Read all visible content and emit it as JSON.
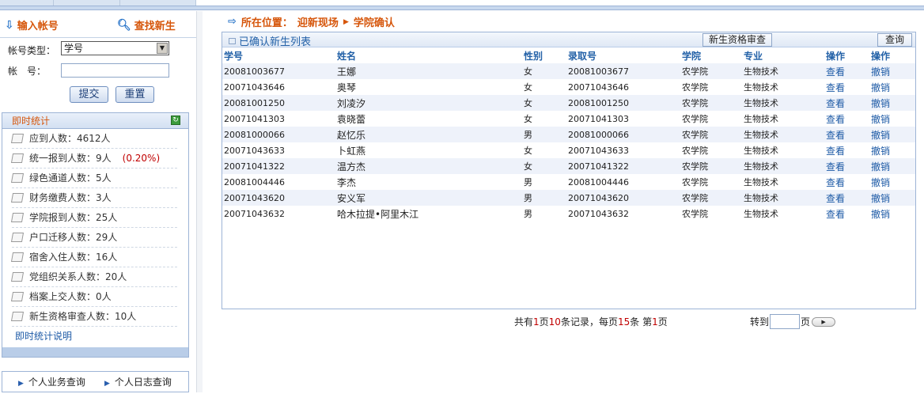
{
  "left": {
    "tabs": [
      {
        "icon": "down-arrow-icon",
        "label": "输入帐号"
      },
      {
        "icon": "search-icon",
        "label": "查找新生"
      }
    ],
    "account_type_label": "帐号类型：",
    "account_type_value": "学号",
    "account_label": "帐　号：",
    "account_value": "",
    "submit_label": "提交",
    "reset_label": "重置",
    "stats_title": "即时统计",
    "stats": [
      {
        "text": "应到人数：4612人",
        "pct": ""
      },
      {
        "text": "统一报到人数：9人",
        "pct": "(0.20%)"
      },
      {
        "text": "绿色通道人数：5人",
        "pct": ""
      },
      {
        "text": "财务缴费人数：3人",
        "pct": ""
      },
      {
        "text": "学院报到人数：25人",
        "pct": ""
      },
      {
        "text": "户口迁移人数：29人",
        "pct": ""
      },
      {
        "text": "宿舍入住人数：16人",
        "pct": ""
      },
      {
        "text": "党组织关系人数：20人",
        "pct": ""
      },
      {
        "text": "档案上交人数：0人",
        "pct": ""
      },
      {
        "text": "新生资格审查人数：10人",
        "pct": ""
      }
    ],
    "stats_link": "即时统计说明",
    "bottom_links": [
      "个人业务查询",
      "个人日志查询"
    ]
  },
  "breadcrumb": {
    "prefix": "所在位置：",
    "items": [
      "迎新现场",
      "学院确认"
    ]
  },
  "panel": {
    "title": "已确认新生列表",
    "review_button": "新生资格审查",
    "query_button": "查询",
    "columns": [
      "学号",
      "姓名",
      "性别",
      "录取号",
      "学院",
      "专业",
      "操作",
      "操作"
    ],
    "rows": [
      [
        "20081003677",
        "王娜",
        "女",
        "20081003677",
        "农学院",
        "生物技术",
        "查看",
        "撤销"
      ],
      [
        "20071043646",
        "奥琴",
        "女",
        "20071043646",
        "农学院",
        "生物技术",
        "查看",
        "撤销"
      ],
      [
        "20081001250",
        "刘凌汐",
        "女",
        "20081001250",
        "农学院",
        "生物技术",
        "查看",
        "撤销"
      ],
      [
        "20071041303",
        "袁晓蕾",
        "女",
        "20071041303",
        "农学院",
        "生物技术",
        "查看",
        "撤销"
      ],
      [
        "20081000066",
        "赵忆乐",
        "男",
        "20081000066",
        "农学院",
        "生物技术",
        "查看",
        "撤销"
      ],
      [
        "20071043633",
        "卜虹燕",
        "女",
        "20071043633",
        "农学院",
        "生物技术",
        "查看",
        "撤销"
      ],
      [
        "20071041322",
        "温方杰",
        "女",
        "20071041322",
        "农学院",
        "生物技术",
        "查看",
        "撤销"
      ],
      [
        "20081004446",
        "李杰",
        "男",
        "20081004446",
        "农学院",
        "生物技术",
        "查看",
        "撤销"
      ],
      [
        "20071043620",
        "安义军",
        "男",
        "20071043620",
        "农学院",
        "生物技术",
        "查看",
        "撤销"
      ],
      [
        "20071043632",
        "哈木拉提•阿里木江",
        "男",
        "20071043632",
        "农学院",
        "生物技术",
        "查看",
        "撤销"
      ]
    ]
  },
  "pager": {
    "t1": "共有",
    "pages": "1",
    "t2": "页",
    "records": "10",
    "t3": "条记录，每页",
    "per_page": "15",
    "t4": "条 第",
    "current": "1",
    "t5": "页",
    "goto_label": "转到",
    "goto_value": "",
    "page_unit": "页"
  },
  "colors": {
    "accent": "#d6560b",
    "link": "#1d5aa6",
    "header_blue": "#2462a8",
    "highlight_red": "#c00000"
  }
}
